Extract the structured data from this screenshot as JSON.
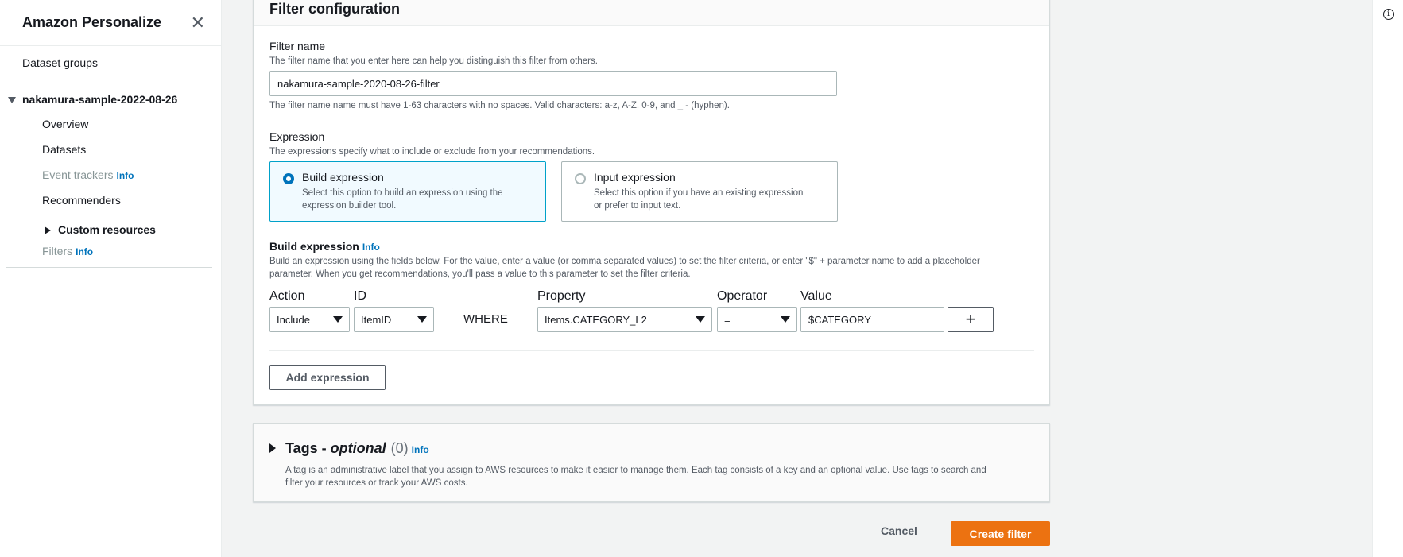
{
  "sidebar": {
    "title": "Amazon Personalize",
    "close_icon": "✕",
    "dataset_groups": "Dataset groups",
    "group_name": "nakamura-sample-2022-08-26",
    "items": {
      "overview": "Overview",
      "datasets": "Datasets",
      "event_trackers": "Event trackers",
      "recommenders": "Recommenders",
      "custom_resources": "Custom resources",
      "filters": "Filters"
    },
    "info": "Info"
  },
  "panel": {
    "title": "Filter configuration"
  },
  "filter_name": {
    "label": "Filter name",
    "description": "The filter name that you enter here can help you distinguish this filter from others.",
    "value": "nakamura-sample-2020-08-26-filter",
    "constraint": "The filter name name must have 1-63 characters with no spaces. Valid characters: a-z, A-Z, 0-9, and _ - (hyphen)."
  },
  "expression": {
    "label": "Expression",
    "description": "The expressions specify what to include or exclude from your recommendations.",
    "options": [
      {
        "title": "Build expression",
        "description_line1": "Select this option to build an expression using the",
        "description_line2": "expression builder tool."
      },
      {
        "title": "Input expression",
        "description_line1": "Select this option if you have an existing expression",
        "description_line2": "or prefer to input text."
      }
    ]
  },
  "build": {
    "label": "Build expression",
    "info": "Info",
    "description_line1": "Build an expression using the fields below. For the value, enter a value (or comma separated values) to set the filter criteria, or enter \"$\" + parameter name to add a placeholder",
    "description_line2": "parameter. When you get recommendations, you'll pass a value to this parameter to set the filter criteria.",
    "columns": {
      "action": "Action",
      "id": "ID",
      "property": "Property",
      "operator": "Operator",
      "value": "Value"
    },
    "row": {
      "action": "Include",
      "id": "ItemID",
      "where": "WHERE",
      "property": "Items.CATEGORY_L2",
      "operator": "=",
      "value": "$CATEGORY",
      "plus": "+"
    },
    "add_expression": "Add expression"
  },
  "tags": {
    "title_prefix": "Tags - ",
    "title_optional": "optional",
    "count": "(0)",
    "info": "Info",
    "description_line1": "A tag is an administrative label that you assign to AWS resources to make it easier to manage them. Each tag consists of a key and an optional value. Use tags to search and",
    "description_line2": "filter your resources or track your AWS costs."
  },
  "footer": {
    "cancel": "Cancel",
    "create": "Create filter"
  },
  "icons": {
    "close": "close-icon",
    "expand": "caret-down-icon",
    "collapse": "caret-right-icon",
    "info": "info-icon"
  },
  "colors": {
    "primary": "#ec7211",
    "link": "#0073bb",
    "selected_border": "#00a1c9",
    "selected_bg": "#f1faff"
  }
}
